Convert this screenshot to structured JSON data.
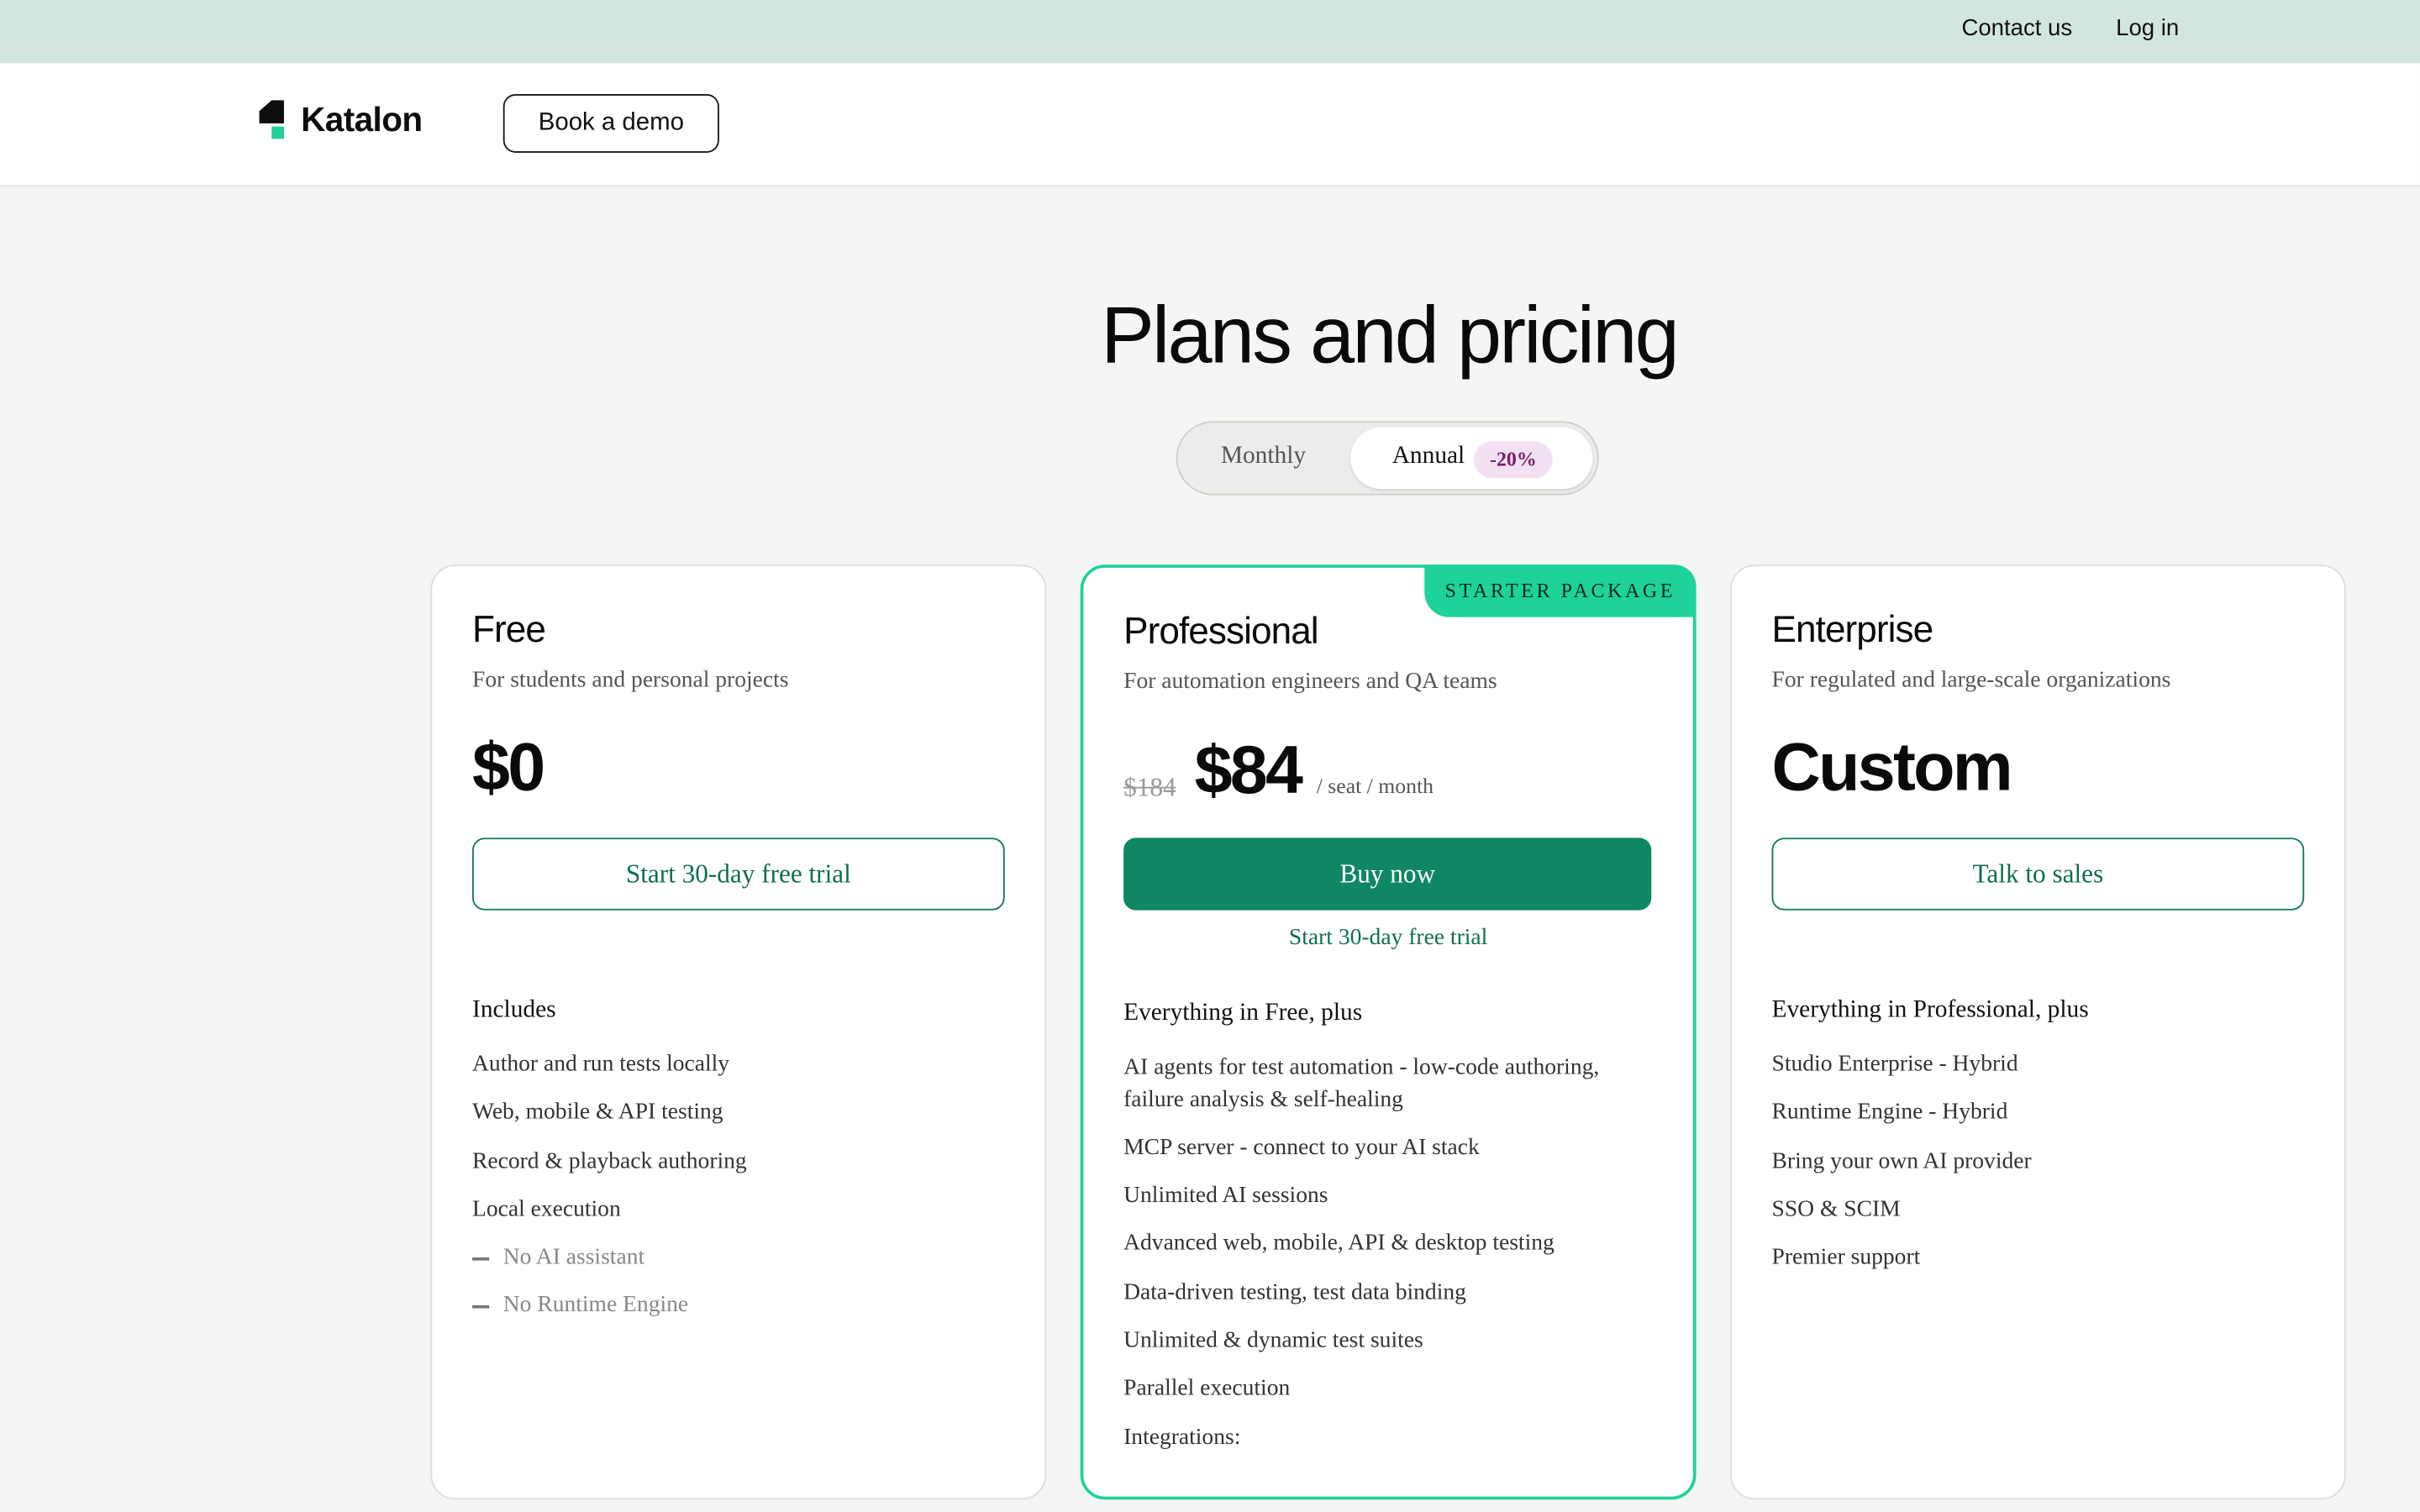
{
  "topbar": {
    "contact": "Contact us",
    "login": "Log in"
  },
  "navbar": {
    "brand": "Katalon",
    "book_demo": "Book a demo"
  },
  "main": {
    "title": "Plans and pricing",
    "billing_toggle": {
      "monthly": "Monthly",
      "annual": "Annual",
      "annual_badge": "-20%",
      "selected": "Annual"
    }
  },
  "plans": [
    {
      "name": "Free",
      "description": "For students and personal projects",
      "price": "$0",
      "cta": "Start 30-day free trial",
      "section_heading": "Includes",
      "features": [
        {
          "text": "Author and run tests locally",
          "included": true
        },
        {
          "text": "Web, mobile & API testing",
          "included": true
        },
        {
          "text": "Record & playback authoring",
          "included": true
        },
        {
          "text": "Local execution",
          "included": true
        },
        {
          "text": "No AI assistant",
          "included": false
        },
        {
          "text": "No Runtime Engine",
          "included": false
        }
      ]
    },
    {
      "name": "Professional",
      "tag": "STARTER PACKAGE",
      "description": "For automation engineers and QA teams",
      "old_price": "$184",
      "price": "$84",
      "price_unit": "/ seat / month",
      "cta": "Buy now",
      "secondary_cta": "Start 30-day free trial",
      "section_heading": "Everything in Free, plus",
      "features": [
        {
          "text": "AI agents for test automation - low-code authoring, failure analysis & self-healing",
          "included": true
        },
        {
          "text": "MCP server - connect to your AI stack",
          "included": true
        },
        {
          "text": "Unlimited AI sessions",
          "included": true
        },
        {
          "text": "Advanced web, mobile, API & desktop testing",
          "included": true
        },
        {
          "text": "Data-driven testing, test data binding",
          "included": true
        },
        {
          "text": "Unlimited & dynamic test suites",
          "included": true
        },
        {
          "text": "Parallel execution",
          "included": true
        },
        {
          "text": "Integrations:",
          "included": true
        }
      ]
    },
    {
      "name": "Enterprise",
      "description": "For regulated and large-scale organizations",
      "price": "Custom",
      "cta": "Talk to sales",
      "section_heading": "Everything in Professional, plus",
      "features": [
        {
          "text": "Studio Enterprise - Hybrid",
          "included": true
        },
        {
          "text": "Runtime Engine - Hybrid",
          "included": true
        },
        {
          "text": "Bring your own AI provider",
          "included": true
        },
        {
          "text": "SSO & SCIM",
          "included": true
        },
        {
          "text": "Premier support",
          "included": true
        }
      ]
    }
  ],
  "colors": {
    "topbar_bg": "#d1e6de",
    "accent_green": "#1fd19a",
    "button_green": "#0f8762",
    "badge_bg": "#f3e1f3"
  }
}
